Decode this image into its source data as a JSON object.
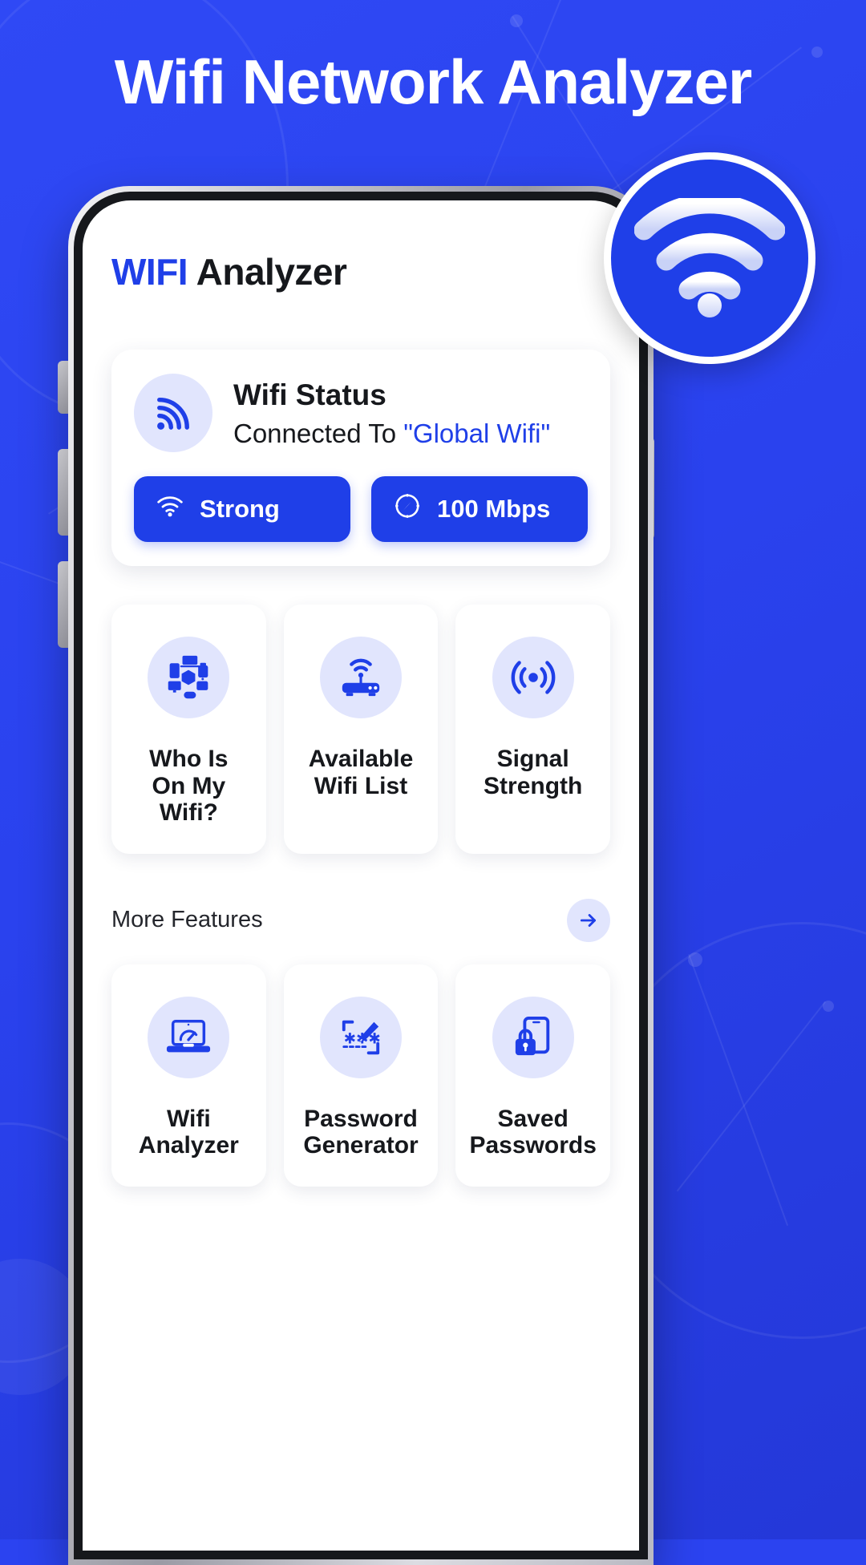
{
  "hero": {
    "title": "Wifi Network Analyzer"
  },
  "brand": {
    "accent": "#1f3fe8",
    "background": "#2b43f0",
    "icon_bg": "#e1e5fd"
  },
  "app": {
    "title_blue": "WIFI",
    "title_rest": " Analyzer",
    "status": {
      "heading": "Wifi Status",
      "connected_label": "Connected To ",
      "network_name": "\"Global Wifi\"",
      "pills": [
        {
          "icon": "wifi-icon",
          "label": "Strong"
        },
        {
          "icon": "speedometer-icon",
          "label": "100 Mbps"
        }
      ]
    },
    "features": [
      {
        "icon": "devices-network-icon",
        "label": "Who Is\nOn My Wifi?"
      },
      {
        "icon": "router-icon",
        "label": "Available\nWifi List"
      },
      {
        "icon": "signal-radar-icon",
        "label": "Signal\nStrength"
      }
    ],
    "more_features": {
      "title": "More Features",
      "arrow_icon": "arrow-right-icon",
      "items": [
        {
          "icon": "laptop-speed-icon",
          "label": "Wifi\nAnalyzer"
        },
        {
          "icon": "password-edit-icon",
          "label": "Password\nGenerator"
        },
        {
          "icon": "phone-lock-icon",
          "label": "Saved\nPasswords"
        }
      ]
    }
  }
}
